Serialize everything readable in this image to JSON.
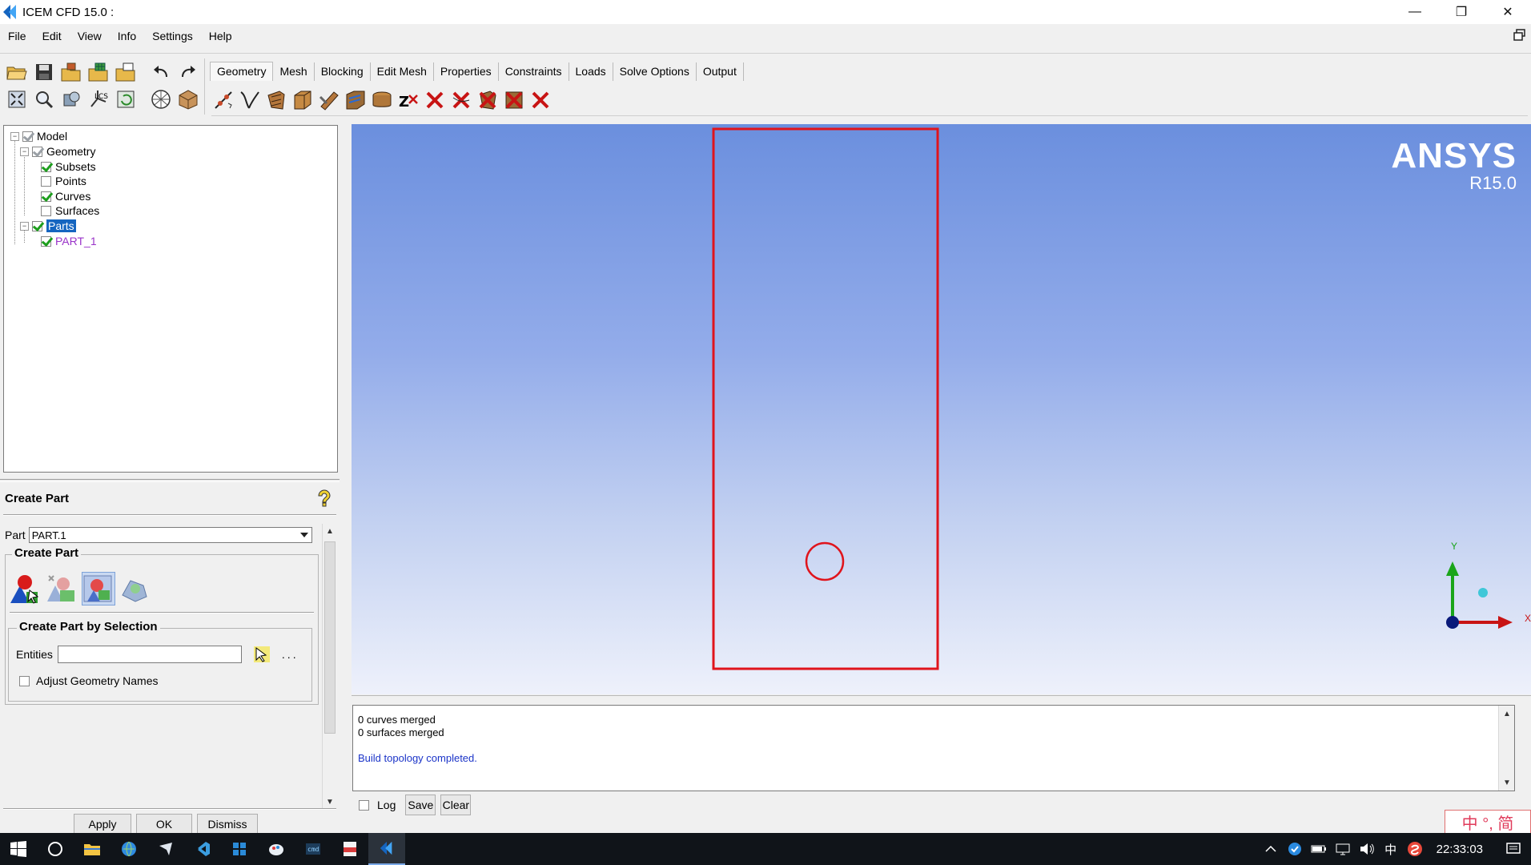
{
  "window": {
    "title": "ICEM CFD 15.0 :"
  },
  "menu": [
    "File",
    "Edit",
    "View",
    "Info",
    "Settings",
    "Help"
  ],
  "tabs": [
    "Geometry",
    "Mesh",
    "Blocking",
    "Edit Mesh",
    "Properties",
    "Constraints",
    "Loads",
    "Solve Options",
    "Output"
  ],
  "active_tab": "Geometry",
  "tree": {
    "model": "Model",
    "geometry": "Geometry",
    "subsets": "Subsets",
    "points": "Points",
    "curves": "Curves",
    "surfaces": "Surfaces",
    "parts": "Parts",
    "part1": "PART_1"
  },
  "panel": {
    "title": "Create Part",
    "part_label": "Part",
    "part_value": "PART.1",
    "group_title": "Create Part",
    "selection_title": "Create Part by Selection",
    "entities_label": "Entities",
    "more_label": "...",
    "adjust_label": "Adjust Geometry Names",
    "apply": "Apply",
    "ok": "OK",
    "dismiss": "Dismiss"
  },
  "viewport": {
    "brand": "ANSYS",
    "version": "R15.0",
    "axis_y": "Y",
    "axis_x": "X",
    "geometry_color": "#e0141c"
  },
  "messages": {
    "lines": [
      "0 curves merged",
      "0 surfaces merged"
    ],
    "status": "Build topology completed.",
    "log_label": "Log",
    "save": "Save",
    "clear": "Clear"
  },
  "ime": {
    "text": "中 °, 简"
  },
  "taskbar": {
    "tray_lang": "中",
    "clock": "22:33:03"
  },
  "icons": {
    "toolbar_left": [
      "open-folder-icon",
      "save-icon",
      "open-geometry-icon",
      "open-mesh-icon",
      "open-blocking-icon",
      "undo-icon",
      "redo-icon",
      "fit-window-icon",
      "zoom-box-icon",
      "view-options-icon",
      "coordinate-system-icon",
      "refresh-icon",
      "wireframe-icon",
      "solid-icon"
    ],
    "geometry_tools": [
      "create-point-icon",
      "create-curve-icon",
      "create-surface-icon",
      "create-body-icon",
      "repair-geometry-icon",
      "geometry-faceted-icon",
      "transform-icon",
      "restore-dormant-icon",
      "delete-point-icon",
      "delete-curve-icon",
      "delete-surface-icon",
      "delete-body-icon",
      "delete-any-icon"
    ]
  }
}
